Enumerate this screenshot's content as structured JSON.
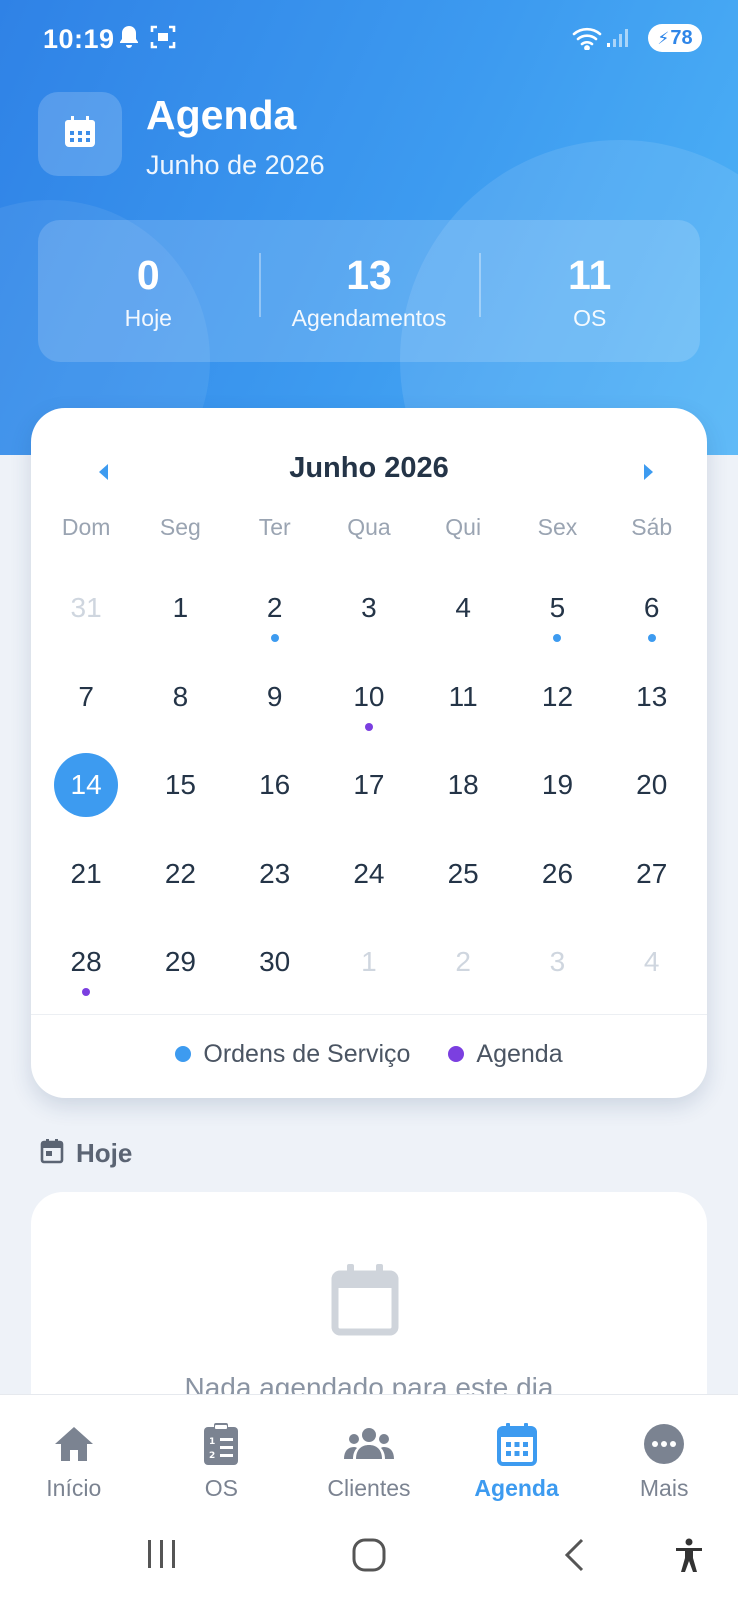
{
  "status_bar": {
    "time": "10:19",
    "battery": "78",
    "icons": [
      "bell-icon",
      "screenshot-icon",
      "wifi-icon",
      "signal-icon",
      "battery-icon"
    ]
  },
  "header": {
    "title": "Agenda",
    "subtitle": "Junho de 2026",
    "icon": "calendar-icon",
    "stats": [
      {
        "value": "0",
        "label": "Hoje"
      },
      {
        "value": "13",
        "label": "Agendamentos"
      },
      {
        "value": "11",
        "label": "OS"
      }
    ]
  },
  "calendar": {
    "month_title": "Junho 2026",
    "weekdays": [
      "Dom",
      "Seg",
      "Ter",
      "Qua",
      "Qui",
      "Sex",
      "Sáb"
    ],
    "weeks": [
      [
        {
          "d": "31",
          "muted": true
        },
        {
          "d": "1"
        },
        {
          "d": "2",
          "dot": "os"
        },
        {
          "d": "3"
        },
        {
          "d": "4"
        },
        {
          "d": "5",
          "dot": "os"
        },
        {
          "d": "6",
          "dot": "os"
        }
      ],
      [
        {
          "d": "7"
        },
        {
          "d": "8"
        },
        {
          "d": "9"
        },
        {
          "d": "10",
          "dot": "agenda"
        },
        {
          "d": "11"
        },
        {
          "d": "12"
        },
        {
          "d": "13"
        }
      ],
      [
        {
          "d": "14",
          "selected": true
        },
        {
          "d": "15"
        },
        {
          "d": "16"
        },
        {
          "d": "17"
        },
        {
          "d": "18"
        },
        {
          "d": "19"
        },
        {
          "d": "20"
        }
      ],
      [
        {
          "d": "21"
        },
        {
          "d": "22"
        },
        {
          "d": "23"
        },
        {
          "d": "24"
        },
        {
          "d": "25"
        },
        {
          "d": "26"
        },
        {
          "d": "27"
        }
      ],
      [
        {
          "d": "28",
          "dot": "agenda"
        },
        {
          "d": "29"
        },
        {
          "d": "30"
        },
        {
          "d": "1",
          "muted": true
        },
        {
          "d": "2",
          "muted": true
        },
        {
          "d": "3",
          "muted": true
        },
        {
          "d": "4",
          "muted": true
        }
      ]
    ],
    "legend": [
      {
        "label": "Ordens de Serviço",
        "color": "#3d9bf0"
      },
      {
        "label": "Agenda",
        "color": "#7b3fe0"
      }
    ]
  },
  "today": {
    "title": "Hoje",
    "empty_text": "Nada agendado para este dia"
  },
  "bottom_nav": {
    "items": [
      {
        "label": "Início",
        "icon": "home-icon"
      },
      {
        "label": "OS",
        "icon": "clipboard-list-icon"
      },
      {
        "label": "Clientes",
        "icon": "users-icon"
      },
      {
        "label": "Agenda",
        "icon": "calendar-icon",
        "active": true
      },
      {
        "label": "Mais",
        "icon": "more-icon"
      }
    ]
  },
  "colors": {
    "accent": "#3d9bf0",
    "agenda_dot": "#7b3fe0",
    "header_gradient_start": "#2f82e6",
    "header_gradient_end": "#4eb3f6"
  }
}
